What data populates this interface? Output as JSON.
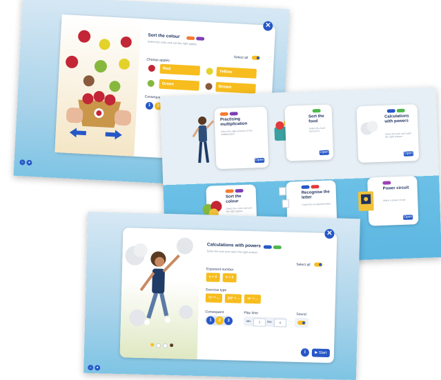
{
  "screen1": {
    "title": "Sort the colour",
    "subtitle": "Select the color and sort the right apples",
    "choose_label": "Choose apples",
    "select_all": "Select all",
    "options": [
      "Red",
      "Yellow",
      "Green",
      "Brown"
    ],
    "consequent_label": "Consequent",
    "consequent_values": [
      "1",
      "2"
    ]
  },
  "screen2": {
    "cards": [
      {
        "title": "Practising multiplication",
        "desc": "Catch the right answers of the multiplication",
        "button": "Open"
      },
      {
        "title": "Sort the food",
        "desc": "Select the food and sort it",
        "button": "Open"
      },
      {
        "title": "Calculations with powers",
        "desc": "Solve the sum and catch the right answer",
        "button": "Open"
      },
      {
        "title": "Sort the colour",
        "desc": "Select the color and sort the right apples",
        "button": ""
      },
      {
        "title": "Recognise the letter",
        "desc": "Catch the recognised letter",
        "button": ""
      },
      {
        "title": "Power circuit",
        "desc": "Make a power circuit",
        "button": "Open"
      }
    ]
  },
  "screen3": {
    "title": "Calculations with powers",
    "subtitle": "Solve the sum and catch the right answer",
    "select_all": "Select all",
    "exponent_label": "Exponent number",
    "exponent_options": [
      "n = 2",
      "n = 3"
    ],
    "exercise_label": "Exercise type",
    "exercise_options": [
      "½ⁿ = ...",
      "(a)ⁿ = ...",
      "-aⁿ = ..."
    ],
    "consequent_label": "Consequent",
    "consequent_values": [
      "1",
      "2",
      "3"
    ],
    "playtime_label": "Play time",
    "playtime_min_label": "Min",
    "playtime_min_value": "1",
    "playtime_sec_label": "Sec",
    "playtime_sec_value": "0",
    "sound_label": "Sound",
    "info_icon": "i",
    "start_label": "Start"
  },
  "colors": {
    "accent": "#2657c7",
    "option": "#f7bd1e",
    "sky": "#a9d3ea"
  }
}
